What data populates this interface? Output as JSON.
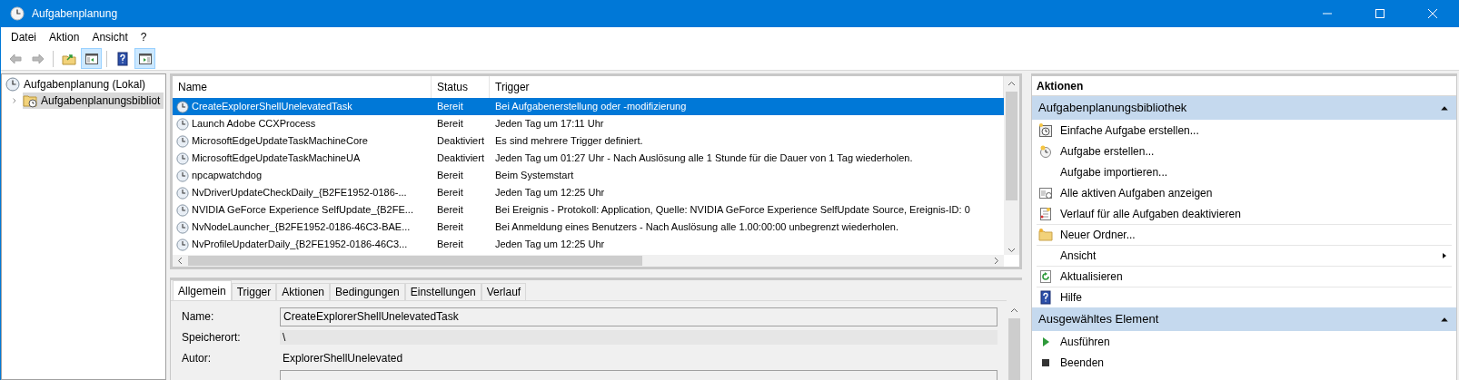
{
  "window": {
    "title": "Aufgabenplanung"
  },
  "menu": [
    "Datei",
    "Aktion",
    "Ansicht",
    "?"
  ],
  "toolbar": [
    {
      "kind": "back",
      "disabled": true,
      "pressed": false
    },
    {
      "kind": "forward",
      "disabled": true,
      "pressed": false
    },
    {
      "kind": "separator"
    },
    {
      "kind": "up",
      "disabled": false,
      "pressed": false
    },
    {
      "kind": "console-tree",
      "disabled": false,
      "pressed": true
    },
    {
      "kind": "separator"
    },
    {
      "kind": "help",
      "disabled": false,
      "pressed": false
    },
    {
      "kind": "action-pane",
      "disabled": false,
      "pressed": true
    }
  ],
  "tree": [
    {
      "label": "Aufgabenplanung (Lokal)",
      "selected": false,
      "children": [
        {
          "label": "Aufgabenplanungsbibliot",
          "selected": true,
          "expanded": false
        }
      ]
    }
  ],
  "tasks": {
    "columns": [
      "Name",
      "Status",
      "Trigger"
    ],
    "rows": [
      {
        "name": "CreateExplorerShellUnelevatedTask",
        "status": "Bereit",
        "trigger": "Bei Aufgabenerstellung oder -modifizierung",
        "selected": true
      },
      {
        "name": "Launch Adobe CCXProcess",
        "status": "Bereit",
        "trigger": "Jeden Tag um 17:11 Uhr",
        "selected": false
      },
      {
        "name": "MicrosoftEdgeUpdateTaskMachineCore",
        "status": "Deaktiviert",
        "trigger": "Es sind mehrere Trigger definiert.",
        "selected": false
      },
      {
        "name": "MicrosoftEdgeUpdateTaskMachineUA",
        "status": "Deaktiviert",
        "trigger": "Jeden Tag um 01:27 Uhr - Nach Auslösung alle 1 Stunde für die Dauer von 1 Tag wiederholen.",
        "selected": false
      },
      {
        "name": "npcapwatchdog",
        "status": "Bereit",
        "trigger": "Beim Systemstart",
        "selected": false
      },
      {
        "name": "NvDriverUpdateCheckDaily_{B2FE1952-0186-...",
        "status": "Bereit",
        "trigger": "Jeden Tag um 12:25 Uhr",
        "selected": false
      },
      {
        "name": "NVIDIA GeForce Experience SelfUpdate_{B2FE...",
        "status": "Bereit",
        "trigger": "Bei Ereignis - Protokoll: Application, Quelle: NVIDIA GeForce Experience SelfUpdate Source, Ereignis-ID: 0",
        "selected": false
      },
      {
        "name": "NvNodeLauncher_{B2FE1952-0186-46C3-BAE...",
        "status": "Bereit",
        "trigger": "Bei Anmeldung eines Benutzers - Nach Auslösung alle 1.00:00:00 unbegrenzt wiederholen.",
        "selected": false
      },
      {
        "name": "NvProfileUpdaterDaily_{B2FE1952-0186-46C3...",
        "status": "Bereit",
        "trigger": "Jeden Tag um 12:25 Uhr",
        "selected": false
      }
    ]
  },
  "details": {
    "tabs": [
      {
        "label": "Allgemein",
        "selected": true
      },
      {
        "label": "Trigger",
        "selected": false
      },
      {
        "label": "Aktionen",
        "selected": false
      },
      {
        "label": "Bedingungen",
        "selected": false
      },
      {
        "label": "Einstellungen",
        "selected": false
      },
      {
        "label": "Verlauf",
        "selected": false
      }
    ],
    "fields": [
      {
        "kind": "input",
        "label": "Name:",
        "value": "CreateExplorerShellUnelevatedTask"
      },
      {
        "kind": "readonly",
        "label": "Speicherort:",
        "value": "\\"
      },
      {
        "kind": "text",
        "label": "Autor:",
        "value": "ExplorerShellUnelevated"
      },
      {
        "kind": "input"
      }
    ]
  },
  "actions": {
    "title": "Aktionen",
    "sections": [
      {
        "title": "Aufgabenplanungsbibliothek",
        "expanded": true,
        "items": [
          {
            "kind": "simple-task",
            "label": "Einfache Aufgabe erstellen...",
            "submenu": false,
            "divider": false
          },
          {
            "kind": "task",
            "label": "Aufgabe erstellen...",
            "submenu": false,
            "divider": false
          },
          {
            "kind": "none",
            "label": "Aufgabe importieren...",
            "submenu": false,
            "divider": false
          },
          {
            "kind": "running",
            "label": "Alle aktiven Aufgaben anzeigen",
            "submenu": false,
            "divider": false
          },
          {
            "kind": "history",
            "label": "Verlauf für alle Aufgaben deaktivieren",
            "submenu": false,
            "divider": false
          },
          {
            "kind": "folder",
            "label": "Neuer Ordner...",
            "submenu": false,
            "divider": true
          },
          {
            "kind": "none",
            "label": "Ansicht",
            "submenu": true,
            "divider": true
          },
          {
            "kind": "refresh",
            "label": "Aktualisieren",
            "submenu": false,
            "divider": true
          },
          {
            "kind": "help",
            "label": "Hilfe",
            "submenu": false,
            "divider": true
          }
        ]
      },
      {
        "title": "Ausgewähltes Element",
        "expanded": true,
        "items": [
          {
            "kind": "run",
            "label": "Ausführen",
            "submenu": false,
            "divider": false
          },
          {
            "kind": "stop",
            "label": "Beenden",
            "submenu": false,
            "divider": false
          }
        ]
      }
    ]
  }
}
